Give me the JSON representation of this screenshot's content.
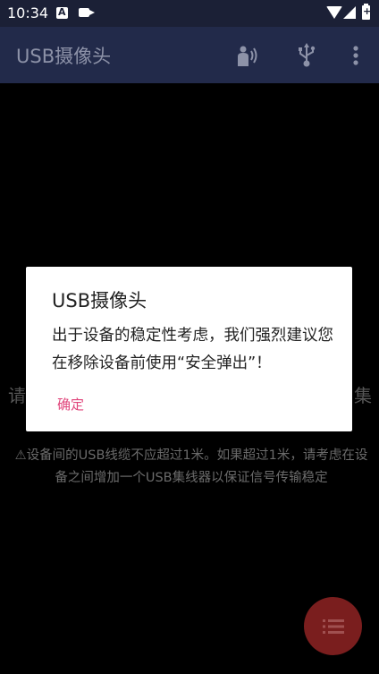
{
  "status_bar": {
    "time": "10:34",
    "icons": [
      "a-notification-icon",
      "video-camera-icon",
      "wifi-icon",
      "cell-signal-icon",
      "battery-icon"
    ]
  },
  "app_bar": {
    "title": "USB摄像头",
    "actions": [
      "voice-icon",
      "usb-icon",
      "more-vert-icon"
    ]
  },
  "background": {
    "left_char": "请",
    "right_char": "集",
    "warning": "⚠设备间的USB线缆不应超过1米。如果超过1米，请考虑在设备之间增加一个USB集线器以保证信号传输稳定"
  },
  "dialog": {
    "title": "USB摄像头",
    "message": "出于设备的稳定性考虑，我们强烈建议您在移除设备前使用“安全弹出”！",
    "ok_label": "确定",
    "accent": "#e0457b"
  },
  "fab": {
    "icon": "list-icon",
    "color": "#7a1e1e"
  },
  "colors": {
    "status_bar": "#1b2036",
    "app_bar": "#222a4a"
  }
}
